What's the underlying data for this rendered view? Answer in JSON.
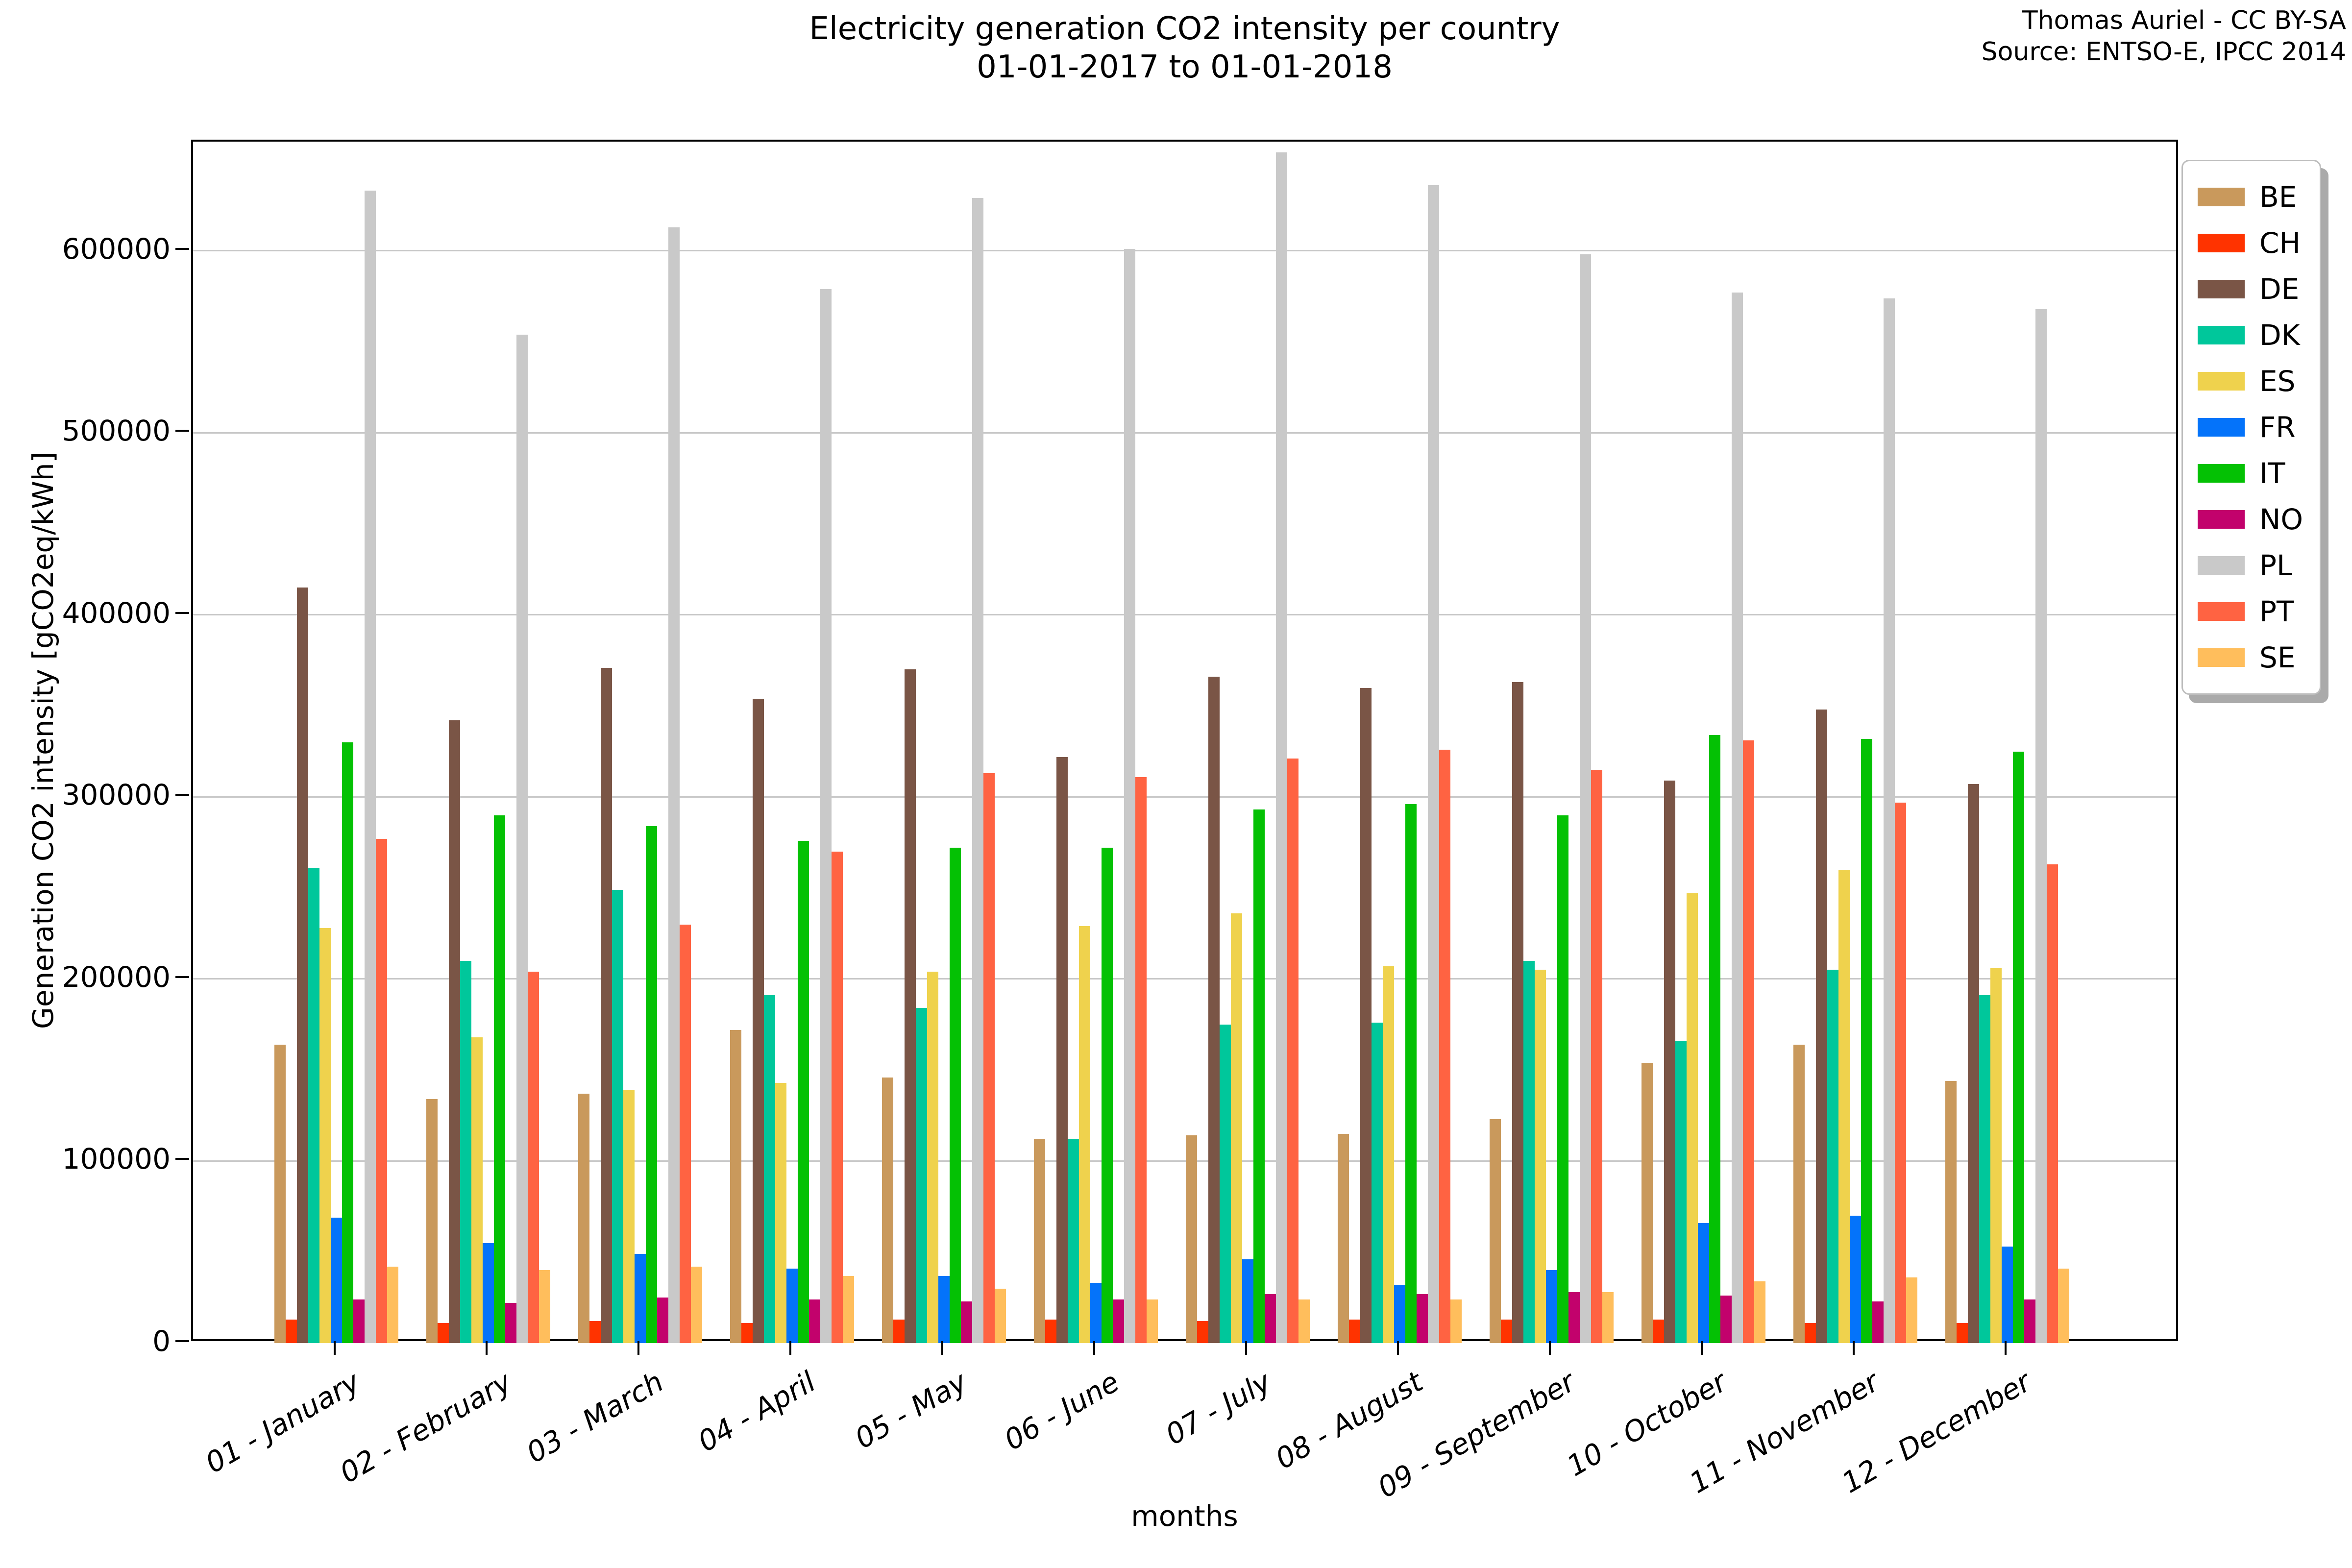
{
  "title": {
    "line1": "Electricity generation CO2 intensity per country",
    "line2": "01-01-2017 to 01-01-2018"
  },
  "attribution": {
    "line1": "Thomas Auriel - CC BY-SA",
    "line2": "Source: ENTSO-E, IPCC 2014"
  },
  "chart_data": {
    "type": "bar",
    "title": "Electricity generation CO2 intensity per country 01-01-2017 to 01-01-2018",
    "xlabel": "months",
    "ylabel": "Generation CO2 intensity [gCO2eq/kWh]",
    "ylim": [
      0,
      660000
    ],
    "yticks": [
      0,
      100000,
      200000,
      300000,
      400000,
      500000,
      600000
    ],
    "grid": "horizontal",
    "legend_position": "outside-right-top",
    "categories": [
      "01 - January",
      "02 - February",
      "03 - March",
      "04 - April",
      "05 - May",
      "06 - June",
      "07 - July",
      "08 - August",
      "09 - September",
      "10 - October",
      "11 - November",
      "12 - December"
    ],
    "series": [
      {
        "name": "BE",
        "color": "#c9995c",
        "values": [
          164000,
          134000,
          137000,
          172000,
          146000,
          112000,
          114000,
          115000,
          123000,
          154000,
          164000,
          144000
        ]
      },
      {
        "name": "CH",
        "color": "#ff3300",
        "values": [
          13000,
          11000,
          12000,
          11000,
          13000,
          13000,
          12000,
          13000,
          13000,
          13000,
          11000,
          11000
        ]
      },
      {
        "name": "DE",
        "color": "#7a5546",
        "values": [
          415000,
          342000,
          371000,
          354000,
          370000,
          322000,
          366000,
          360000,
          363000,
          309000,
          348000,
          307000
        ]
      },
      {
        "name": "DK",
        "color": "#00c79b",
        "values": [
          261000,
          210000,
          249000,
          191000,
          184000,
          112000,
          175000,
          176000,
          210000,
          166000,
          205000,
          191000
        ]
      },
      {
        "name": "ES",
        "color": "#efd24d",
        "values": [
          228000,
          168000,
          139000,
          143000,
          204000,
          229000,
          236000,
          207000,
          205000,
          247000,
          260000,
          206000
        ]
      },
      {
        "name": "FR",
        "color": "#0473fa",
        "values": [
          69000,
          55000,
          49000,
          41000,
          37000,
          33000,
          46000,
          32000,
          40000,
          66000,
          70000,
          53000
        ]
      },
      {
        "name": "IT",
        "color": "#04c104",
        "values": [
          330000,
          290000,
          284000,
          276000,
          272000,
          272000,
          293000,
          296000,
          290000,
          334000,
          332000,
          325000
        ]
      },
      {
        "name": "NO",
        "color": "#c2026c",
        "values": [
          24000,
          22000,
          25000,
          24000,
          23000,
          24000,
          27000,
          27000,
          28000,
          26000,
          23000,
          24000
        ]
      },
      {
        "name": "PL",
        "color": "#c9c9c9",
        "values": [
          633000,
          554000,
          613000,
          579000,
          629000,
          601000,
          654000,
          636000,
          598000,
          577000,
          574000,
          568000
        ]
      },
      {
        "name": "PT",
        "color": "#ff6342",
        "values": [
          277000,
          204000,
          230000,
          270000,
          313000,
          311000,
          321000,
          326000,
          315000,
          331000,
          297000,
          263000
        ]
      },
      {
        "name": "SE",
        "color": "#ffbe5c",
        "values": [
          42000,
          40000,
          42000,
          37000,
          30000,
          24000,
          24000,
          24000,
          28000,
          34000,
          36000,
          41000
        ]
      }
    ]
  }
}
